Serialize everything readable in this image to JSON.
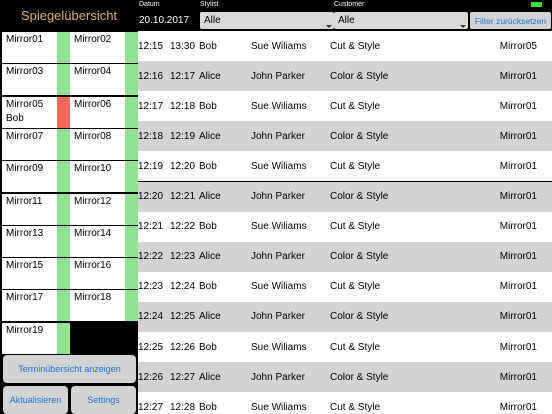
{
  "left_panel": {
    "title": "Spiegelübersicht",
    "mirrors": [
      {
        "label": "Mirror01",
        "user": "",
        "status": "free"
      },
      {
        "label": "Mirror02",
        "user": "",
        "status": "free"
      },
      {
        "label": "Mirror03",
        "user": "",
        "status": "free"
      },
      {
        "label": "Mirror04",
        "user": "",
        "status": "free"
      },
      {
        "label": "Mirror05",
        "user": "Bob",
        "status": "busy"
      },
      {
        "label": "Mirror06",
        "user": "",
        "status": "free"
      },
      {
        "label": "Mirror07",
        "user": "",
        "status": "free"
      },
      {
        "label": "Mirror08",
        "user": "",
        "status": "free"
      },
      {
        "label": "Mirror09",
        "user": "",
        "status": "free"
      },
      {
        "label": "Mirror10",
        "user": "",
        "status": "free"
      },
      {
        "label": "Mirror11",
        "user": "",
        "status": "free"
      },
      {
        "label": "Mirror12",
        "user": "",
        "status": "free"
      },
      {
        "label": "Mirror13",
        "user": "",
        "status": "free"
      },
      {
        "label": "Mirror14",
        "user": "",
        "status": "free"
      },
      {
        "label": "Mirror15",
        "user": "",
        "status": "free"
      },
      {
        "label": "Mirror16",
        "user": "",
        "status": "free"
      },
      {
        "label": "Mirror17",
        "user": "",
        "status": "free"
      },
      {
        "label": "Mirror18",
        "user": "",
        "status": "free"
      },
      {
        "label": "Mirror19",
        "user": "",
        "status": "free"
      }
    ],
    "buttons": {
      "overview": "Terminübersicht anzeigen",
      "refresh": "Aktualisieren",
      "settings": "Settings"
    }
  },
  "filters": {
    "date_label": "Datum",
    "date_value": "20.10.2017",
    "stylist_label": "Stylist",
    "stylist_value": "Alle",
    "customer_label": "Customer",
    "customer_value": "Alle",
    "reset_label": "Filter zurücksetzen"
  },
  "appointments": [
    {
      "start": "12:15",
      "end": "13:30",
      "stylist": "Bob",
      "customer": "Sue Wiliams",
      "service": "Cut & Style",
      "mirror": "Mirror05"
    },
    {
      "start": "12:16",
      "end": "12:17",
      "stylist": "Alice",
      "customer": "John Parker",
      "service": "Color & Style",
      "mirror": "Mirror01"
    },
    {
      "start": "12:17",
      "end": "12:18",
      "stylist": "Bob",
      "customer": "Sue Wiliams",
      "service": "Cut & Style",
      "mirror": "Mirror01"
    },
    {
      "start": "12:18",
      "end": "12:19",
      "stylist": "Alice",
      "customer": "John Parker",
      "service": "Color & Style",
      "mirror": "Mirror01"
    },
    {
      "start": "12:19",
      "end": "12:20",
      "stylist": "Bob",
      "customer": "Sue Wiliams",
      "service": "Cut & Style",
      "mirror": "Mirror01"
    },
    {
      "start": "12:20",
      "end": "12:21",
      "stylist": "Alice",
      "customer": "John Parker",
      "service": "Color & Style",
      "mirror": "Mirror01"
    },
    {
      "start": "12:21",
      "end": "12:22",
      "stylist": "Bob",
      "customer": "Sue Wiliams",
      "service": "Cut & Style",
      "mirror": "Mirror01"
    },
    {
      "start": "12:22",
      "end": "12:23",
      "stylist": "Alice",
      "customer": "John Parker",
      "service": "Color & Style",
      "mirror": "Mirror01"
    },
    {
      "start": "12:23",
      "end": "12:24",
      "stylist": "Bob",
      "customer": "Sue Wiliams",
      "service": "Cut & Style",
      "mirror": "Mirror01"
    },
    {
      "start": "12:24",
      "end": "12:25",
      "stylist": "Alice",
      "customer": "John Parker",
      "service": "Color & Style",
      "mirror": "Mirror01"
    },
    {
      "start": "12:25",
      "end": "12:26",
      "stylist": "Bob",
      "customer": "Sue Wiliams",
      "service": "Cut & Style",
      "mirror": "Mirror01"
    },
    {
      "start": "12:26",
      "end": "12:27",
      "stylist": "Alice",
      "customer": "John Parker",
      "service": "Color & Style",
      "mirror": "Mirror01"
    },
    {
      "start": "12:27",
      "end": "12:28",
      "stylist": "Bob",
      "customer": "Sue Wiliams",
      "service": "Cut & Style",
      "mirror": "Mirror01"
    }
  ],
  "colors": {
    "free": "#8fe28f",
    "busy": "#f06a58",
    "accent": "#1a73d9",
    "title": "#e0b35a"
  }
}
